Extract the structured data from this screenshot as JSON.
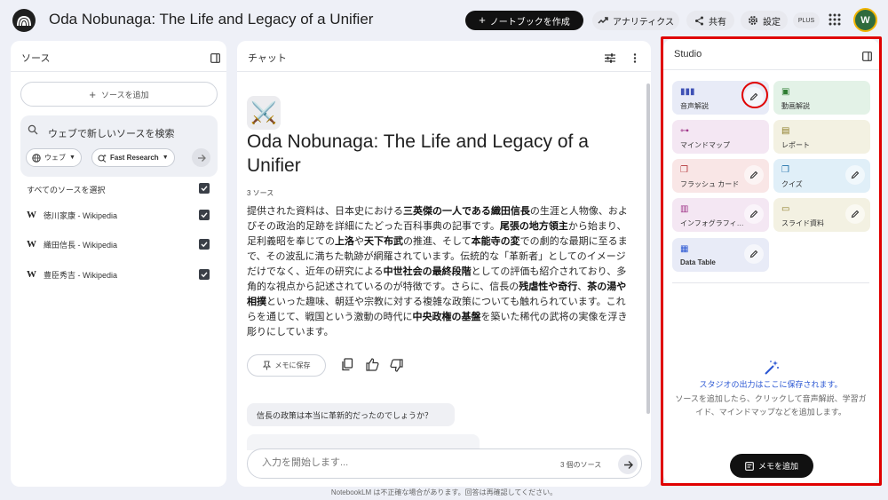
{
  "header": {
    "title": "Oda Nobunaga: The Life and Legacy of a Unifier",
    "create_notebook": "ノートブックを作成",
    "analytics": "アナリティクス",
    "share": "共有",
    "settings": "設定",
    "plan_badge": "PLUS",
    "avatar_initial": "W"
  },
  "sources": {
    "title": "ソース",
    "add_source": "ソースを追加",
    "search_text": "ウェブで新しいソースを検索",
    "web_chip": "ウェブ",
    "research_chip": "Fast Research",
    "select_all": "すべてのソースを選択",
    "items": [
      {
        "label": "徳川家康 - Wikipedia"
      },
      {
        "label": "織田信長 - Wikipedia"
      },
      {
        "label": "豊臣秀吉 - Wikipedia"
      }
    ]
  },
  "chat": {
    "title": "チャット",
    "emoji": "⚔️",
    "doc_title": "Oda Nobunaga: The Life and Legacy of a Unifier",
    "source_count": "3 ソース",
    "summary": [
      {
        "t": "提供された資料は、日本史における"
      },
      {
        "t": "三英傑の一人である織田信長",
        "b": true
      },
      {
        "t": "の生涯と人物像、およびその政治的足跡を詳細にたどった百科事典の記事です。"
      },
      {
        "t": "尾張の地方領主",
        "b": true
      },
      {
        "t": "から始まり、足利義昭を奉じての"
      },
      {
        "t": "上洛",
        "b": true
      },
      {
        "t": "や"
      },
      {
        "t": "天下布武",
        "b": true
      },
      {
        "t": "の推進、そして"
      },
      {
        "t": "本能寺の変",
        "b": true
      },
      {
        "t": "での劇的な最期に至るまで、その波乱に満ちた軌跡が網羅されています。伝統的な「革新者」としてのイメージだけでなく、近年の研究による"
      },
      {
        "t": "中世社会の最終段階",
        "b": true
      },
      {
        "t": "としての評価も紹介されており、多角的な視点から記述されているのが特徴です。さらに、信長の"
      },
      {
        "t": "残虐性や奇行",
        "b": true
      },
      {
        "t": "、"
      },
      {
        "t": "茶の湯や相撲",
        "b": true
      },
      {
        "t": "といった趣味、朝廷や宗教に対する複雑な政策についても触れられています。これらを通じて、戦国という激動の時代に"
      },
      {
        "t": "中央政権の基盤",
        "b": true
      },
      {
        "t": "を築いた稀代の武将の実像を浮き彫りにしています。"
      }
    ],
    "save_memo": "メモに保存",
    "suggestion": "信長の政策は本当に革新的だったのでしょうか？",
    "input_placeholder": "入力を開始します...",
    "input_source_count": "3 個のソース"
  },
  "studio": {
    "title": "Studio",
    "tiles": [
      {
        "label": "音声解説",
        "bg": "#e8ebf7",
        "icon_color": "#3f51b5"
      },
      {
        "label": "動画解説",
        "bg": "#e3f2e7",
        "icon_color": "#2e7d32"
      },
      {
        "label": "マインドマップ",
        "bg": "#f4e7f3",
        "icon_color": "#a0368a"
      },
      {
        "label": "レポート",
        "bg": "#f3f1e2",
        "icon_color": "#8a7a22"
      },
      {
        "label": "フラッシュ カード",
        "bg": "#f9e6e6",
        "icon_color": "#b3353a"
      },
      {
        "label": "クイズ",
        "bg": "#e0eff8",
        "icon_color": "#1e6fa8"
      },
      {
        "label": "インフォグラフィック",
        "bg": "#f4e7f3",
        "icon_color": "#a0368a"
      },
      {
        "label": "スライド資料",
        "bg": "#f3f1e2",
        "icon_color": "#8a7a22"
      },
      {
        "label": "Data Table",
        "bg": "#e8ebf7",
        "icon_color": "#2b57d3"
      }
    ],
    "empty_title": "スタジオの出力はここに保存されます。",
    "empty_desc": "ソースを追加したら、クリックして音声解説、学習ガイド、マインドマップなどを追加します。",
    "add_memo": "メモを追加"
  },
  "footer": "NotebookLM は不正確な場合があります。回答は再確認してください。"
}
